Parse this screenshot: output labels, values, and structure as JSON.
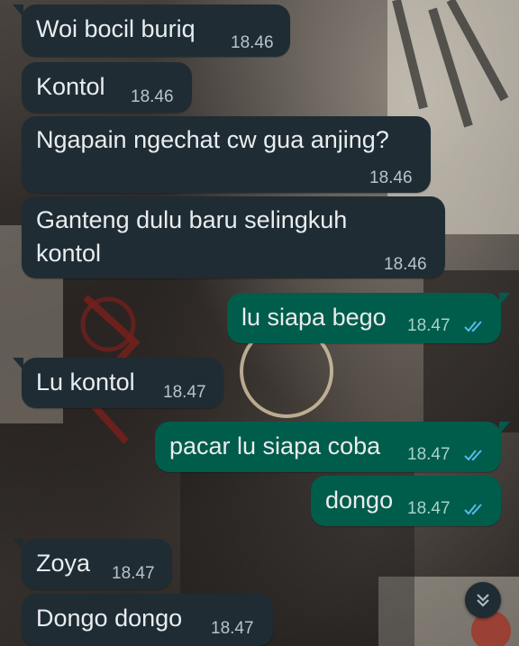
{
  "messages": [
    {
      "dir": "in",
      "text": "Woi bocil buriq",
      "time": "18.46"
    },
    {
      "dir": "in",
      "text": "Kontol",
      "time": "18.46"
    },
    {
      "dir": "in",
      "text": "Ngapain ngechat cw gua anjing?",
      "time": "18.46"
    },
    {
      "dir": "in",
      "text_line1": "Ganteng dulu baru selingkuh",
      "text_line2": "kontol",
      "time": "18.46"
    },
    {
      "dir": "out",
      "text": "lu siapa bego",
      "time": "18.47",
      "status": "read-ticks-icon"
    },
    {
      "dir": "in",
      "text": "Lu kontol",
      "time": "18.47"
    },
    {
      "dir": "out",
      "text": "pacar lu siapa coba",
      "time": "18.47",
      "status": "read-ticks-icon"
    },
    {
      "dir": "out",
      "text": "dongo",
      "time": "18.47",
      "status": "read-ticks-icon"
    },
    {
      "dir": "in",
      "text": "Zoya",
      "time": "18.47"
    },
    {
      "dir": "in",
      "text": "Dongo dongo",
      "time": "18.47"
    }
  ],
  "scroll_button": {
    "icon": "double-chevron-down-icon"
  },
  "colors": {
    "incoming_bubble": "#1f2c33",
    "outgoing_bubble": "#005c4b",
    "text": "#e9edef",
    "read_ticks": "#53bdeb"
  }
}
